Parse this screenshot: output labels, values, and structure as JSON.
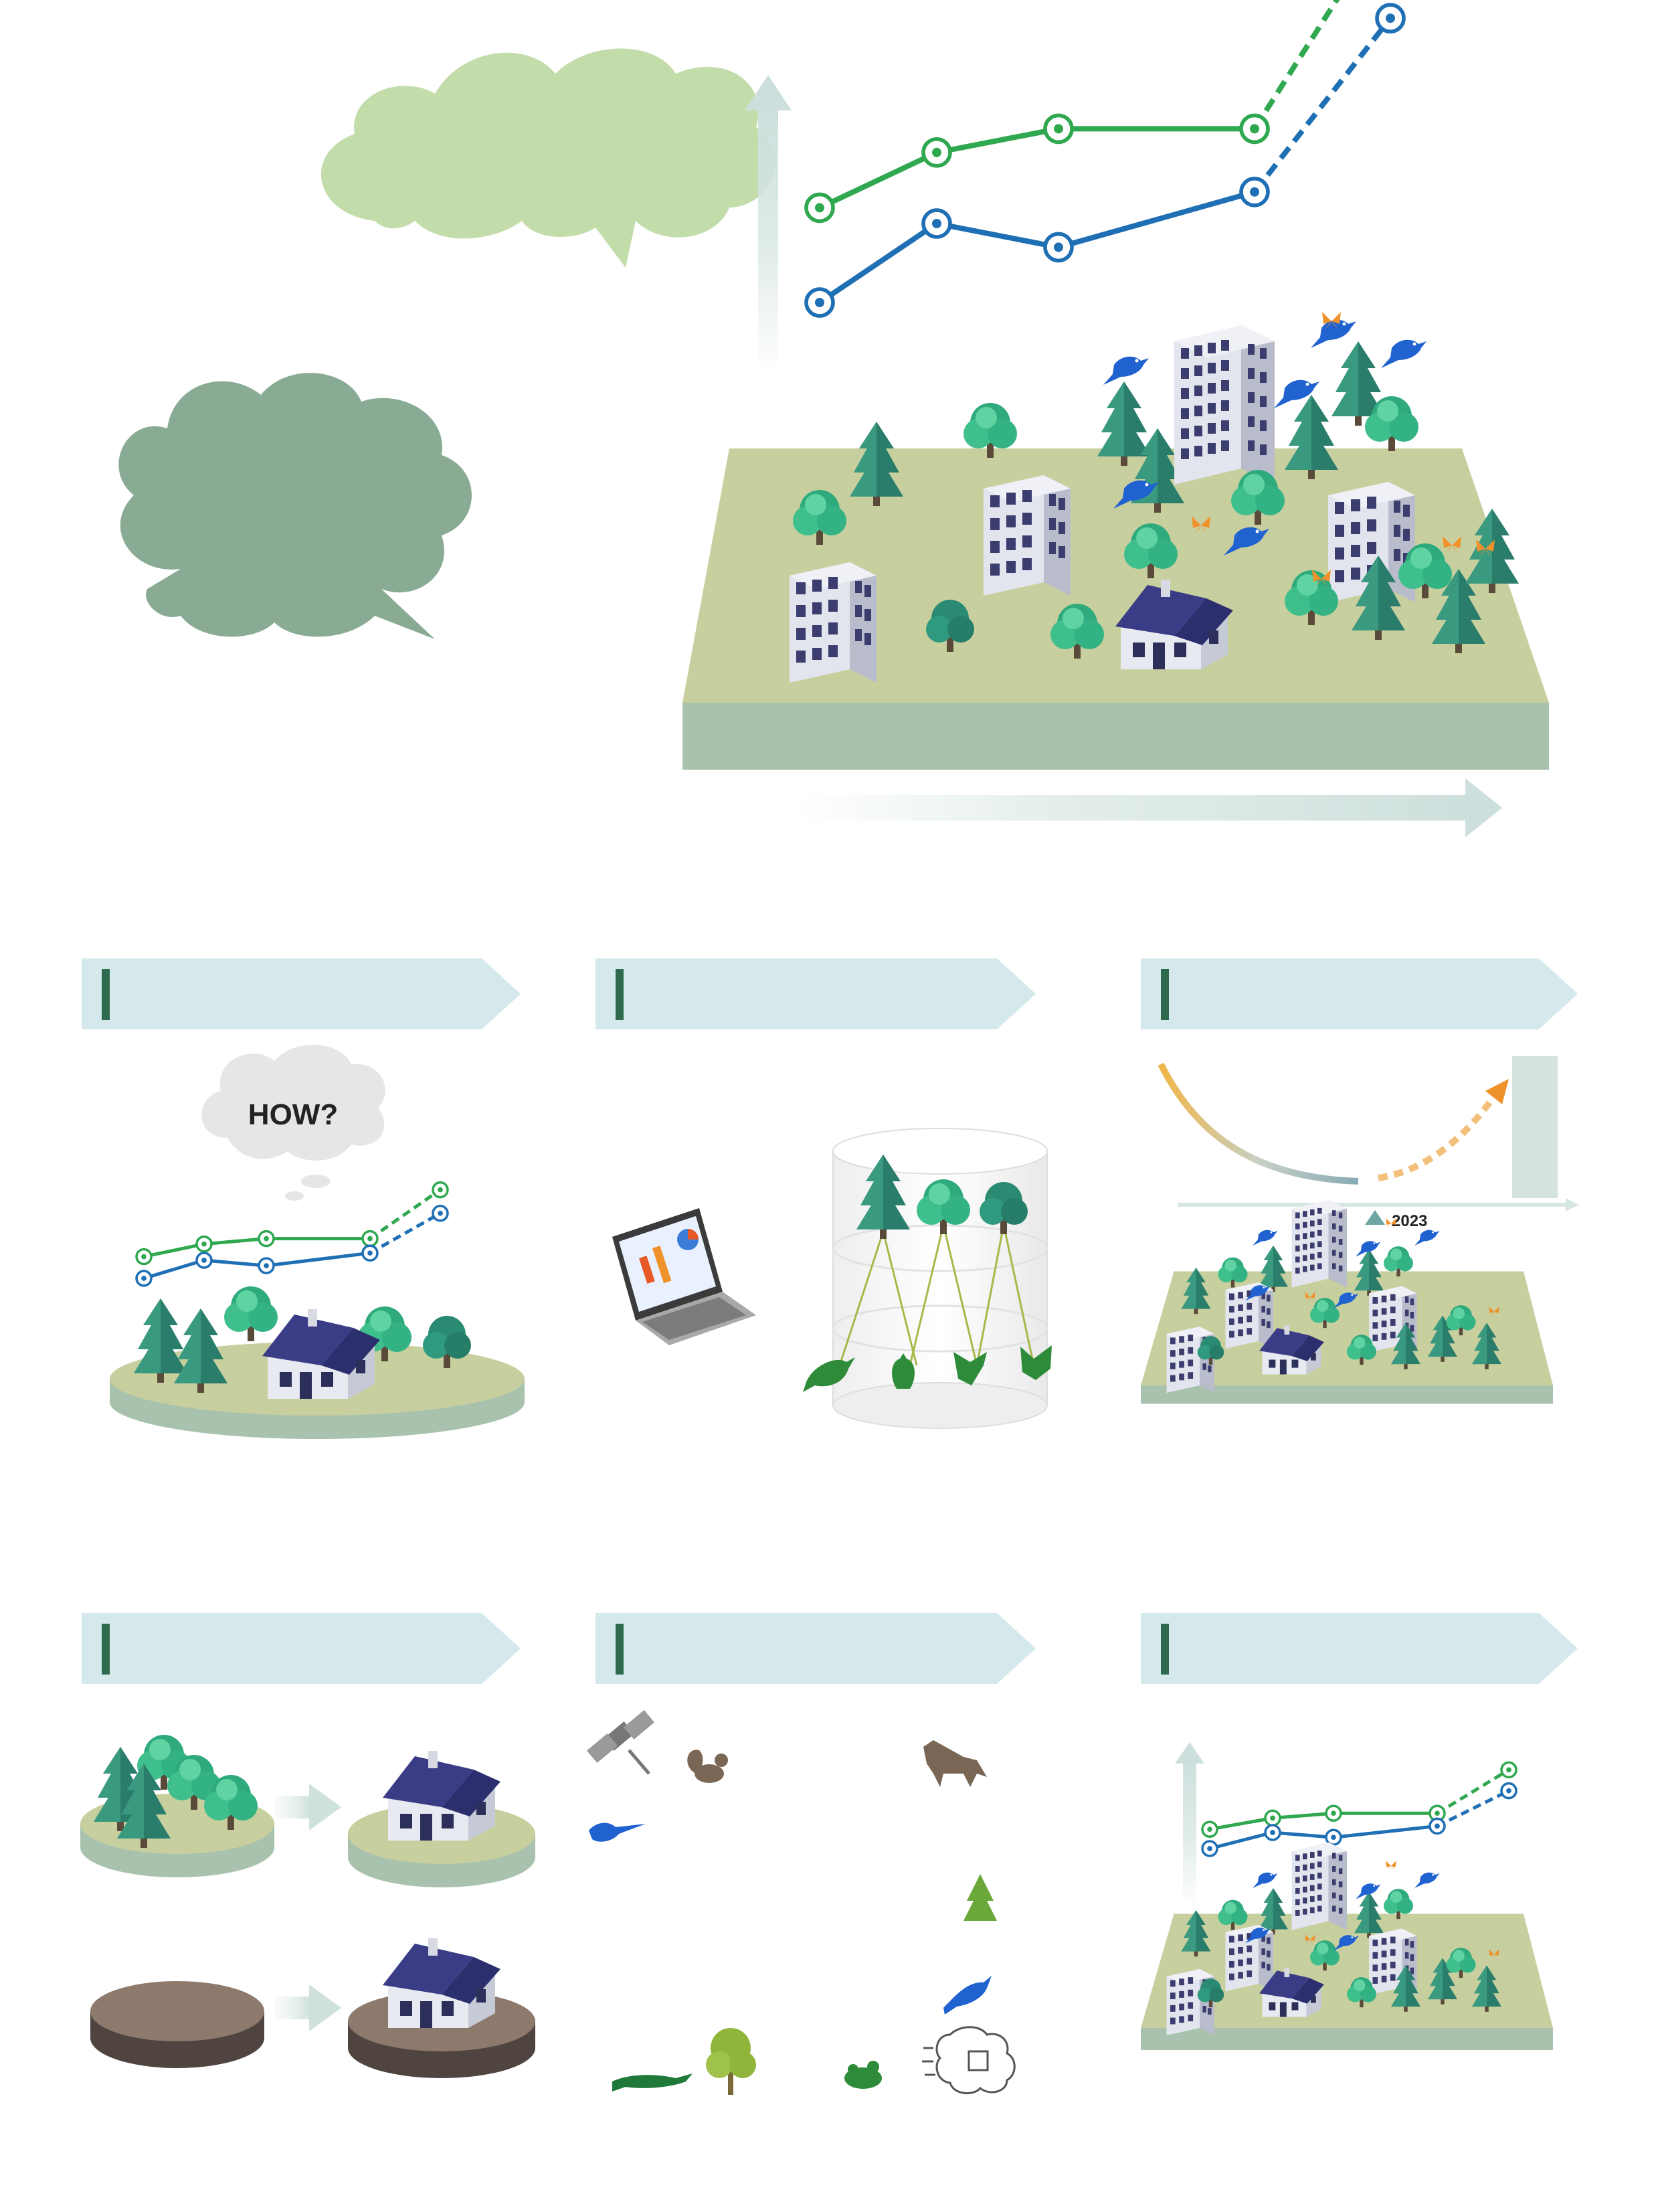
{
  "colors": {
    "green_series": "#2fa84f",
    "blue_series": "#1f6fb5",
    "banner_fill": "#d5e9ec",
    "banner_bar": "#2e6b4e",
    "bubble_light": "#c2dcaa",
    "bubble_dark": "#8aab93",
    "ground_top": "#c8cf9f",
    "ground_side": "#a8c2ae",
    "tree_dark": "#2a7d6a",
    "tree_light": "#3fb98a",
    "roof": "#3a3d86",
    "bird_blue": "#1f62d0",
    "butterfly_orange": "#f0922c",
    "soil": "#8d7a6c",
    "animal_brown": "#7a6654",
    "species_green": "#2e8b3a"
  },
  "top_chart": {
    "green_series": [
      2.2,
      2.9,
      3.2,
      3.2
    ],
    "green_projection": [
      3.2,
      5.9
    ],
    "blue_series": [
      1.0,
      2.0,
      1.7,
      2.4
    ],
    "blue_projection": [
      2.4,
      4.6
    ]
  },
  "panel1": {
    "thought_text": "HOW?"
  },
  "panel3": {
    "curve_min_label": "2023"
  },
  "icons": {
    "satellite": "satellite-icon",
    "squirrel": "squirrel-icon",
    "fox": "fox-icon",
    "bird": "bird-icon",
    "conifer": "conifer-icon",
    "crocodile": "crocodile-icon",
    "deciduous_tree": "deciduous-tree-icon",
    "frog": "frog-icon",
    "ai_brain": "ai-brain-icon",
    "laptop": "laptop-icon",
    "database": "database-icon"
  }
}
